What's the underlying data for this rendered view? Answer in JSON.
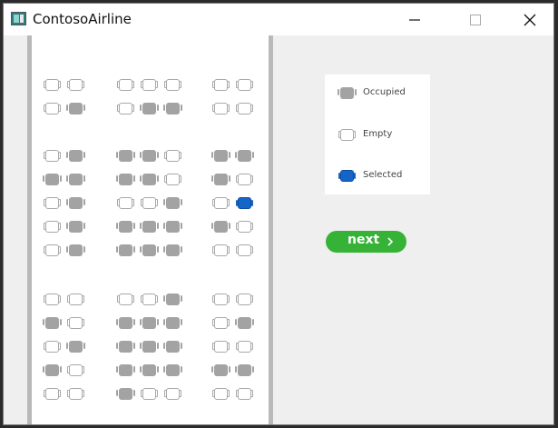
{
  "window": {
    "title": "ContosoAirline",
    "controls": [
      "minimize-icon",
      "maximize-icon",
      "close-icon"
    ]
  },
  "seat_map": {
    "rows": [
      [
        "empty",
        "empty",
        "empty",
        "empty",
        "empty",
        "empty",
        "empty"
      ],
      [
        "empty",
        "occupied",
        "empty",
        "occupied",
        "occupied",
        "empty",
        "empty"
      ],
      [
        "empty",
        "occupied",
        "occupied",
        "occupied",
        "empty",
        "occupied",
        "occupied"
      ],
      [
        "occupied",
        "occupied",
        "occupied",
        "occupied",
        "empty",
        "occupied",
        "empty"
      ],
      [
        "empty",
        "occupied",
        "empty",
        "empty",
        "occupied",
        "empty",
        "selected"
      ],
      [
        "empty",
        "occupied",
        "occupied",
        "occupied",
        "occupied",
        "occupied",
        "empty"
      ],
      [
        "empty",
        "occupied",
        "occupied",
        "occupied",
        "occupied",
        "empty",
        "empty"
      ],
      [
        "empty",
        "empty",
        "empty",
        "empty",
        "occupied",
        "empty",
        "empty"
      ],
      [
        "occupied",
        "empty",
        "occupied",
        "occupied",
        "occupied",
        "empty",
        "occupied"
      ],
      [
        "empty",
        "occupied",
        "occupied",
        "occupied",
        "occupied",
        "empty",
        "empty"
      ],
      [
        "occupied",
        "empty",
        "occupied",
        "occupied",
        "occupied",
        "occupied",
        "occupied"
      ],
      [
        "empty",
        "empty",
        "occupied",
        "empty",
        "empty",
        "empty",
        "empty"
      ]
    ]
  },
  "legend": {
    "items": [
      {
        "state": "occupied",
        "label": "Occupied"
      },
      {
        "state": "empty",
        "label": "Empty"
      },
      {
        "state": "selected",
        "label": "Selected"
      }
    ]
  },
  "next_button": {
    "label": "next",
    "icon": "chevron-right-icon"
  },
  "colors": {
    "occupied": "#a3a3a3",
    "selected": "#1565c8",
    "next_button": "#36b336",
    "cabin_wall": "#b9b9b9"
  }
}
